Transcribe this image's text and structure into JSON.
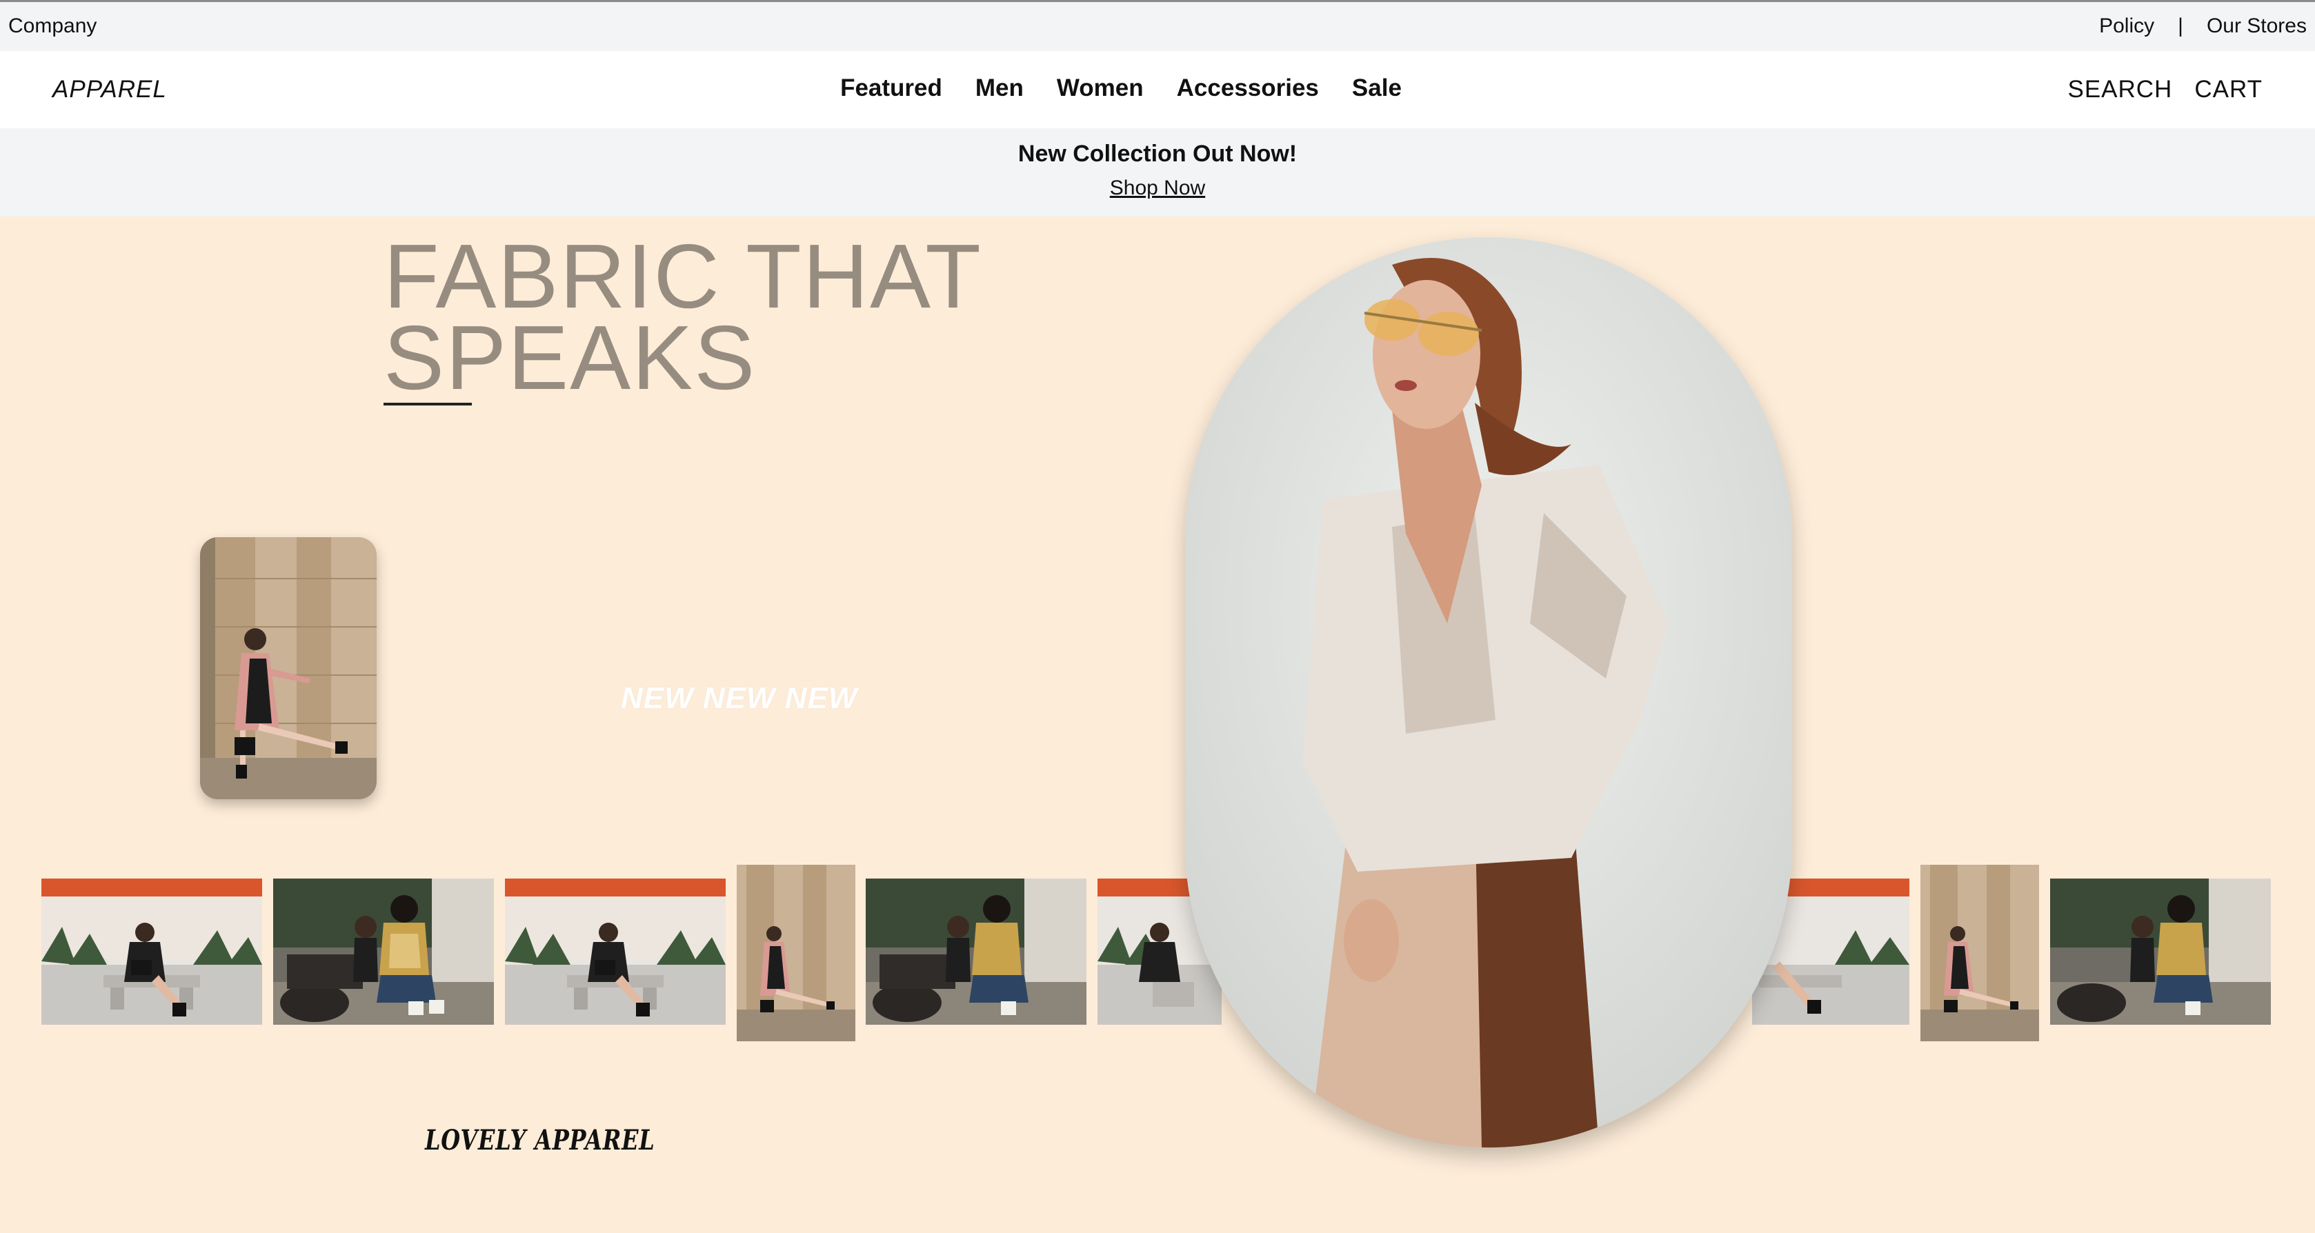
{
  "topbar": {
    "company": "Company",
    "policy": "Policy",
    "separator": "|",
    "stores": "Our Stores"
  },
  "navbar": {
    "logo": "APPAREL",
    "menu": [
      "Featured",
      "Men",
      "Women",
      "Accessories",
      "Sale"
    ],
    "search": "SEARCH",
    "cart": "CART"
  },
  "announcement": {
    "headline": "New Collection Out Now!",
    "link": "Shop Now"
  },
  "hero": {
    "title_line1": "FABRIC THAT",
    "title_line2": "SPEAKS",
    "overlay_text": "NEW NEW NEW",
    "brand_signature": "LOVELY APPAREL"
  },
  "colors": {
    "hero_background": "#fdecd8",
    "title_color": "#978c80",
    "bar_background": "#f3f4f6"
  },
  "icons": [
    "bench-photo",
    "pink-coat-photo",
    "cafe-friends-photo",
    "model-white-shirt-photo"
  ]
}
